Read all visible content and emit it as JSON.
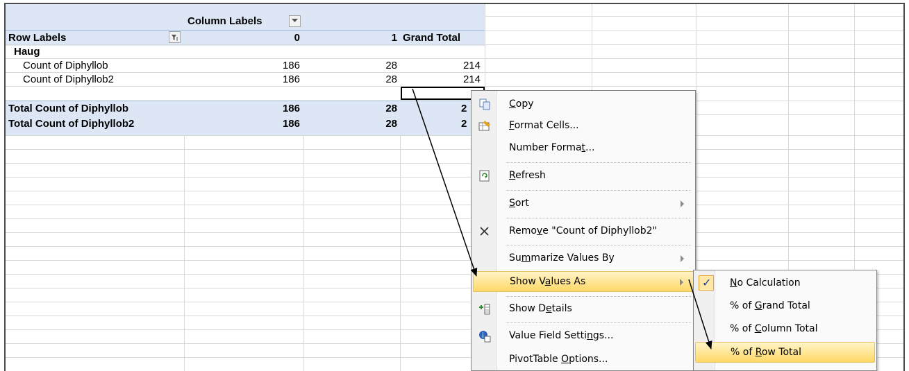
{
  "pivot": {
    "column_labels": "Column Labels",
    "row_labels": "Row Labels",
    "col_0": "0",
    "col_1": "1",
    "grand_total": "Grand Total",
    "group": "Haug",
    "rows": [
      {
        "label": "Count of Diphyllob",
        "v0": "186",
        "v1": "28",
        "total": "214"
      },
      {
        "label": "Count of Diphyllob2",
        "v0": "186",
        "v1": "28",
        "total": "214"
      }
    ],
    "totals": [
      {
        "label": "Total Count of Diphyllob",
        "v0": "186",
        "v1": "28",
        "total": "2"
      },
      {
        "label": "Total Count of Diphyllob2",
        "v0": "186",
        "v1": "28",
        "total": "2"
      }
    ]
  },
  "context_menu": {
    "items": [
      {
        "pre": "",
        "key": "C",
        "post": "opy",
        "icon": "copy-icon"
      },
      {
        "pre": "",
        "key": "F",
        "post": "ormat Cells...",
        "icon": "format-cells-icon"
      },
      {
        "pre": "Number Forma",
        "key": "t",
        "post": "...",
        "icon": ""
      },
      {
        "pre": "",
        "key": "R",
        "post": "efresh",
        "icon": "refresh-icon"
      },
      {
        "pre": "",
        "key": "S",
        "post": "ort",
        "icon": ""
      },
      {
        "pre": "Remo",
        "key": "v",
        "post": "e \"Count of Diphyllob2\"",
        "icon": "remove-x-icon"
      },
      {
        "pre": "Su",
        "key": "m",
        "post": "marize Values By",
        "icon": ""
      },
      {
        "pre": "Show V",
        "key": "a",
        "post": "lues As",
        "icon": ""
      },
      {
        "pre": "Show D",
        "key": "e",
        "post": "tails",
        "icon": "show-details-icon"
      },
      {
        "pre": "Value Field Setti",
        "key": "n",
        "post": "gs...",
        "icon": "value-field-settings-icon"
      },
      {
        "pre": "PivotTable ",
        "key": "O",
        "post": "ptions...",
        "icon": ""
      }
    ]
  },
  "submenu": {
    "items": [
      {
        "pre": "",
        "key": "N",
        "post": "o Calculation",
        "checked": true
      },
      {
        "pre": "% of ",
        "key": "G",
        "post": "rand Total",
        "checked": false
      },
      {
        "pre": "% of ",
        "key": "C",
        "post": "olumn Total",
        "checked": false
      },
      {
        "pre": "% of ",
        "key": "R",
        "post": "ow Total",
        "checked": false
      }
    ]
  },
  "colors": {
    "pivot_band": "#dce6f4",
    "menu_highlight": "#ffd966",
    "grid": "#d9d9d9"
  }
}
